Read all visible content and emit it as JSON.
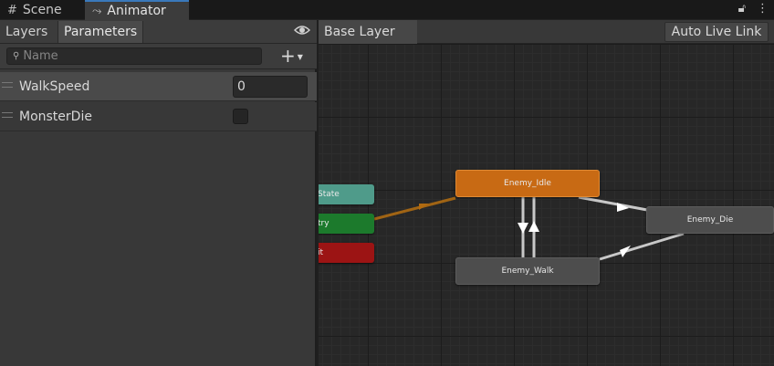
{
  "tabs": {
    "scene": {
      "label": "Scene",
      "icon": "grid-icon"
    },
    "animator": {
      "label": "Animator",
      "icon": "animator-graph-icon"
    },
    "right_icons": [
      "lock-icon",
      "more-menu-icon"
    ]
  },
  "left_panel": {
    "tabs": {
      "layers": "Layers",
      "parameters": "Parameters"
    },
    "visibility_icon": "eye-icon",
    "search": {
      "placeholder": "Name",
      "value": ""
    },
    "add_icon": "plus-icon",
    "parameters": [
      {
        "name": "WalkSpeed",
        "type": "float",
        "value": "0"
      },
      {
        "name": "MonsterDie",
        "type": "bool",
        "value": false
      }
    ]
  },
  "graph": {
    "breadcrumb": "Base Layer",
    "auto_live_link": "Auto Live Link",
    "states": {
      "any_state": "State",
      "entry": "try",
      "exit": "it",
      "idle": "Enemy_Idle",
      "walk": "Enemy_Walk",
      "die": "Enemy_Die"
    },
    "colors": {
      "default_state": "#c86a14",
      "state": "#4d4d4d",
      "any_state": "#4f9b8a",
      "entry": "#1c7a2c",
      "exit": "#9c1414",
      "entry_transition": "#a06414",
      "transition": "#b0b0b0"
    }
  }
}
